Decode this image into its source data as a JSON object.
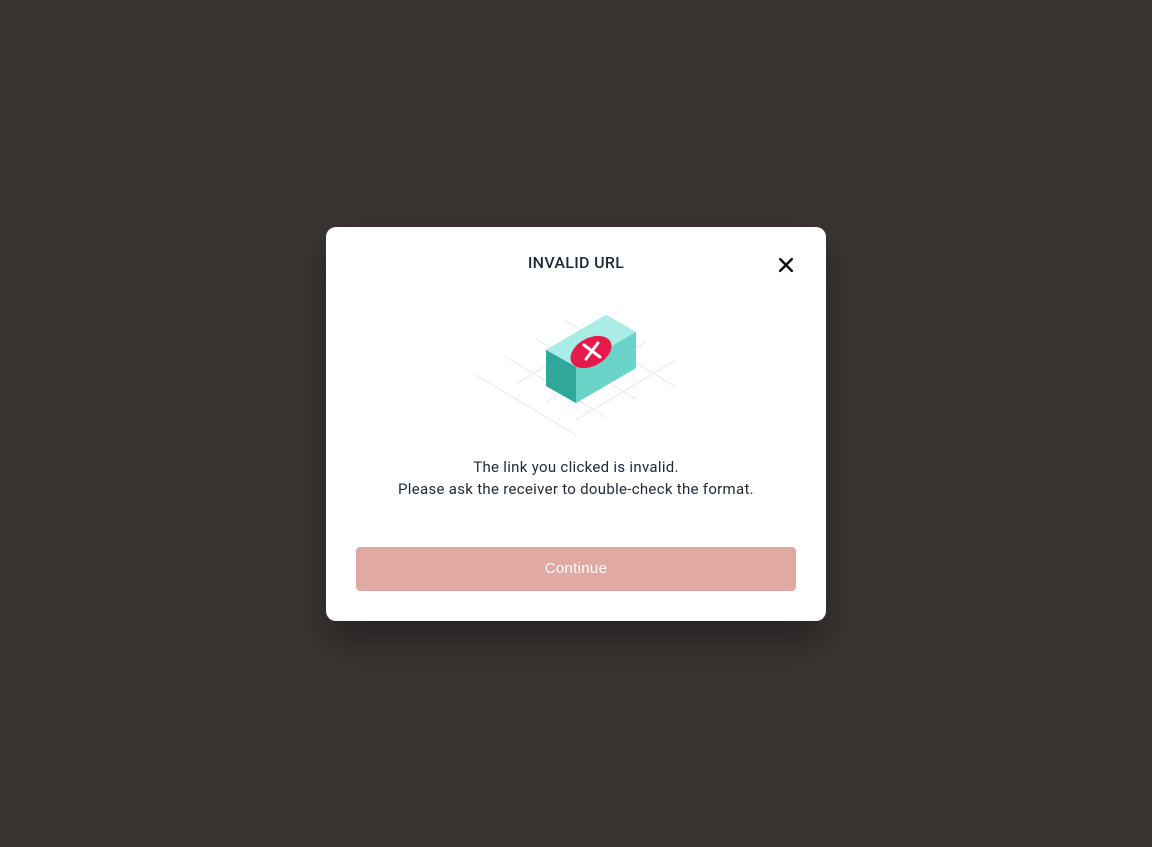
{
  "modal": {
    "title": "INVALID URL",
    "message_line1": "The link you clicked is invalid.",
    "message_line2": "Please ask the receiver to double-check the format.",
    "continue_label": "Continue"
  }
}
